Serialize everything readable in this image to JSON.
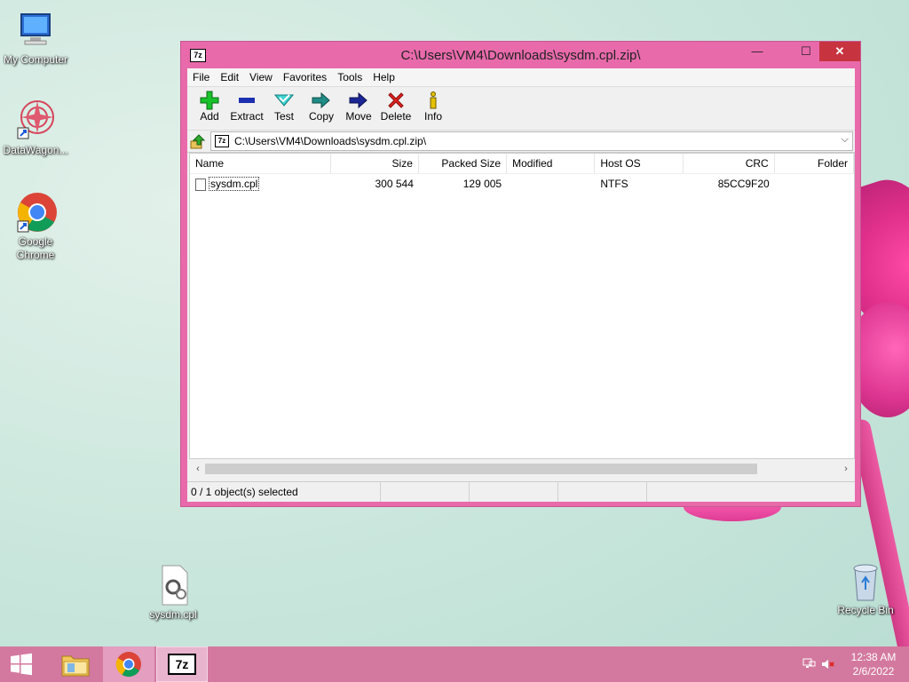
{
  "desktop": {
    "icons": [
      {
        "label": "My Computer"
      },
      {
        "label": "DataWagon..."
      },
      {
        "label": "Google Chrome"
      },
      {
        "label": "sysdm.cpl"
      },
      {
        "label": "Recycle Bin"
      }
    ]
  },
  "window": {
    "title": "C:\\Users\\VM4\\Downloads\\sysdm.cpl.zip\\",
    "app_icon_text": "7z",
    "minimize": "—",
    "maximize": "☐",
    "close": "✕",
    "menu": [
      "File",
      "Edit",
      "View",
      "Favorites",
      "Tools",
      "Help"
    ],
    "toolbar": [
      "Add",
      "Extract",
      "Test",
      "Copy",
      "Move",
      "Delete",
      "Info"
    ],
    "address": "C:\\Users\\VM4\\Downloads\\sysdm.cpl.zip\\",
    "columns": [
      "Name",
      "Size",
      "Packed Size",
      "Modified",
      "Host OS",
      "CRC",
      "Folder"
    ],
    "rows": [
      {
        "name": "sysdm.cpl",
        "size": "300 544",
        "packed": "129 005",
        "modified": "",
        "host_os": "NTFS",
        "crc": "85CC9F20",
        "folder": ""
      }
    ],
    "status": "0 / 1 object(s) selected"
  },
  "taskbar": {
    "time": "12:38 AM",
    "date": "2/6/2022",
    "sevenzip_label": "7z"
  },
  "colors": {
    "window_frame": "#e86aab",
    "taskbar": "#d3799f",
    "close_button": "#c7333f"
  }
}
